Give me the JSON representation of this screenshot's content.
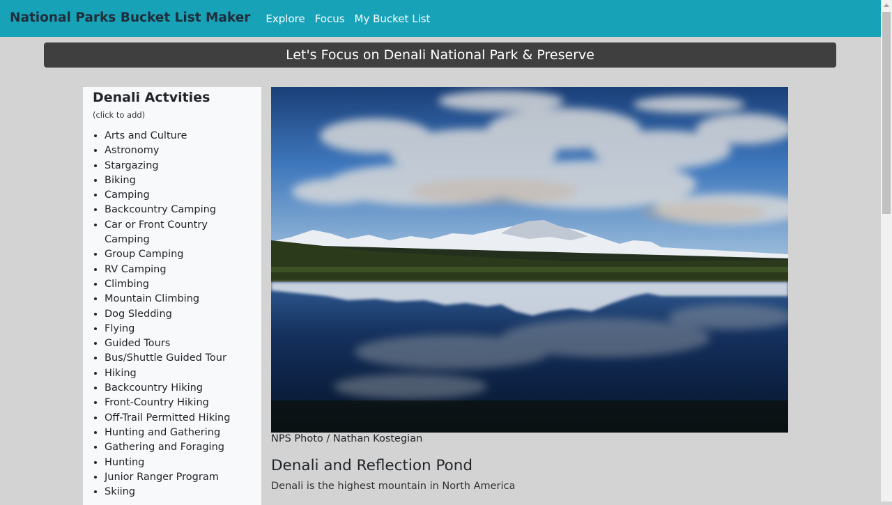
{
  "navbar": {
    "brand": "National Parks Bucket List Maker",
    "links": [
      "Explore",
      "Focus",
      "My Bucket List"
    ]
  },
  "banner": {
    "text": "Let's Focus on Denali National Park & Preserve"
  },
  "sidebar": {
    "title": "Denali Actvities",
    "subtitle": "(click to add)",
    "activities": [
      "Arts and Culture",
      "Astronomy",
      "Stargazing",
      "Biking",
      "Camping",
      "Backcountry Camping",
      "Car or Front Country Camping",
      "Group Camping",
      "RV Camping",
      "Climbing",
      "Mountain Climbing",
      "Dog Sledding",
      "Flying",
      "Guided Tours",
      "Bus/Shuttle Guided Tour",
      "Hiking",
      "Backcountry Hiking",
      "Front-Country Hiking",
      "Off-Trail Permitted Hiking",
      "Hunting and Gathering",
      "Gathering and Foraging",
      "Hunting",
      "Junior Ranger Program",
      "Skiing"
    ]
  },
  "photo": {
    "caption": "NPS Photo / Nathan Kostegian",
    "title": "Denali and Reflection Pond",
    "description": "Denali is the highest mountain in North America"
  },
  "colors": {
    "navbar": "#17a2b8",
    "banner": "#3f3f3f",
    "background": "#d3d3d3",
    "sidebar": "#f8f9fa"
  }
}
